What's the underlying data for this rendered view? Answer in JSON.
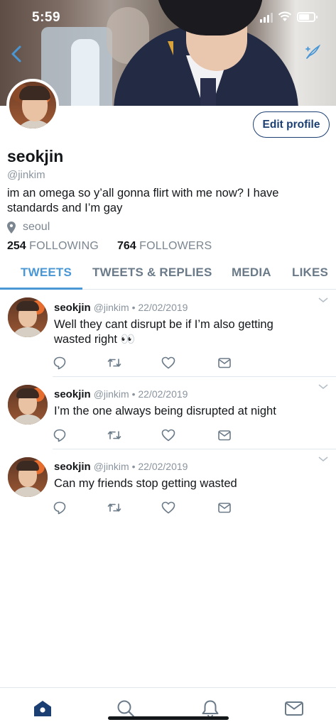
{
  "status_bar": {
    "time": "5:59"
  },
  "header": {
    "back_icon": "chevron-left-icon",
    "compose_icon": "feather-compose-icon"
  },
  "profile": {
    "edit_button": "Edit profile",
    "display_name": "seokjin",
    "handle": "@jinkim",
    "bio": "im an omega so y’all gonna flirt with me now? I have standards and I’m gay",
    "location": "seoul",
    "following_count": "254",
    "following_label": "FOLLOWING",
    "followers_count": "764",
    "followers_label": "FOLLOWERS"
  },
  "tabs": [
    {
      "label": "TWEETS",
      "active": true
    },
    {
      "label": "TWEETS & REPLIES",
      "active": false
    },
    {
      "label": "MEDIA",
      "active": false
    },
    {
      "label": "LIKES",
      "active": false
    }
  ],
  "tweets": [
    {
      "name": "seokjin",
      "meta": "@jinkim • 22/02/2019",
      "text": "Well they cant disrupt be if I’m also getting wasted right 👀"
    },
    {
      "name": "seokjin",
      "meta": "@jinkim • 22/02/2019",
      "text": "I’m the one always being disrupted at night"
    },
    {
      "name": "seokjin",
      "meta": "@jinkim • 22/02/2019",
      "text": "Can my friends stop getting wasted"
    }
  ],
  "bottom_nav": [
    "home-icon",
    "search-icon",
    "notifications-bell-icon",
    "messages-envelope-icon"
  ],
  "colors": {
    "accent": "#4a97d6",
    "edit_border": "#1c3f73",
    "muted_text": "#7b8690",
    "icon_gray": "#6b7a88",
    "nav_active": "#1c3f73"
  }
}
